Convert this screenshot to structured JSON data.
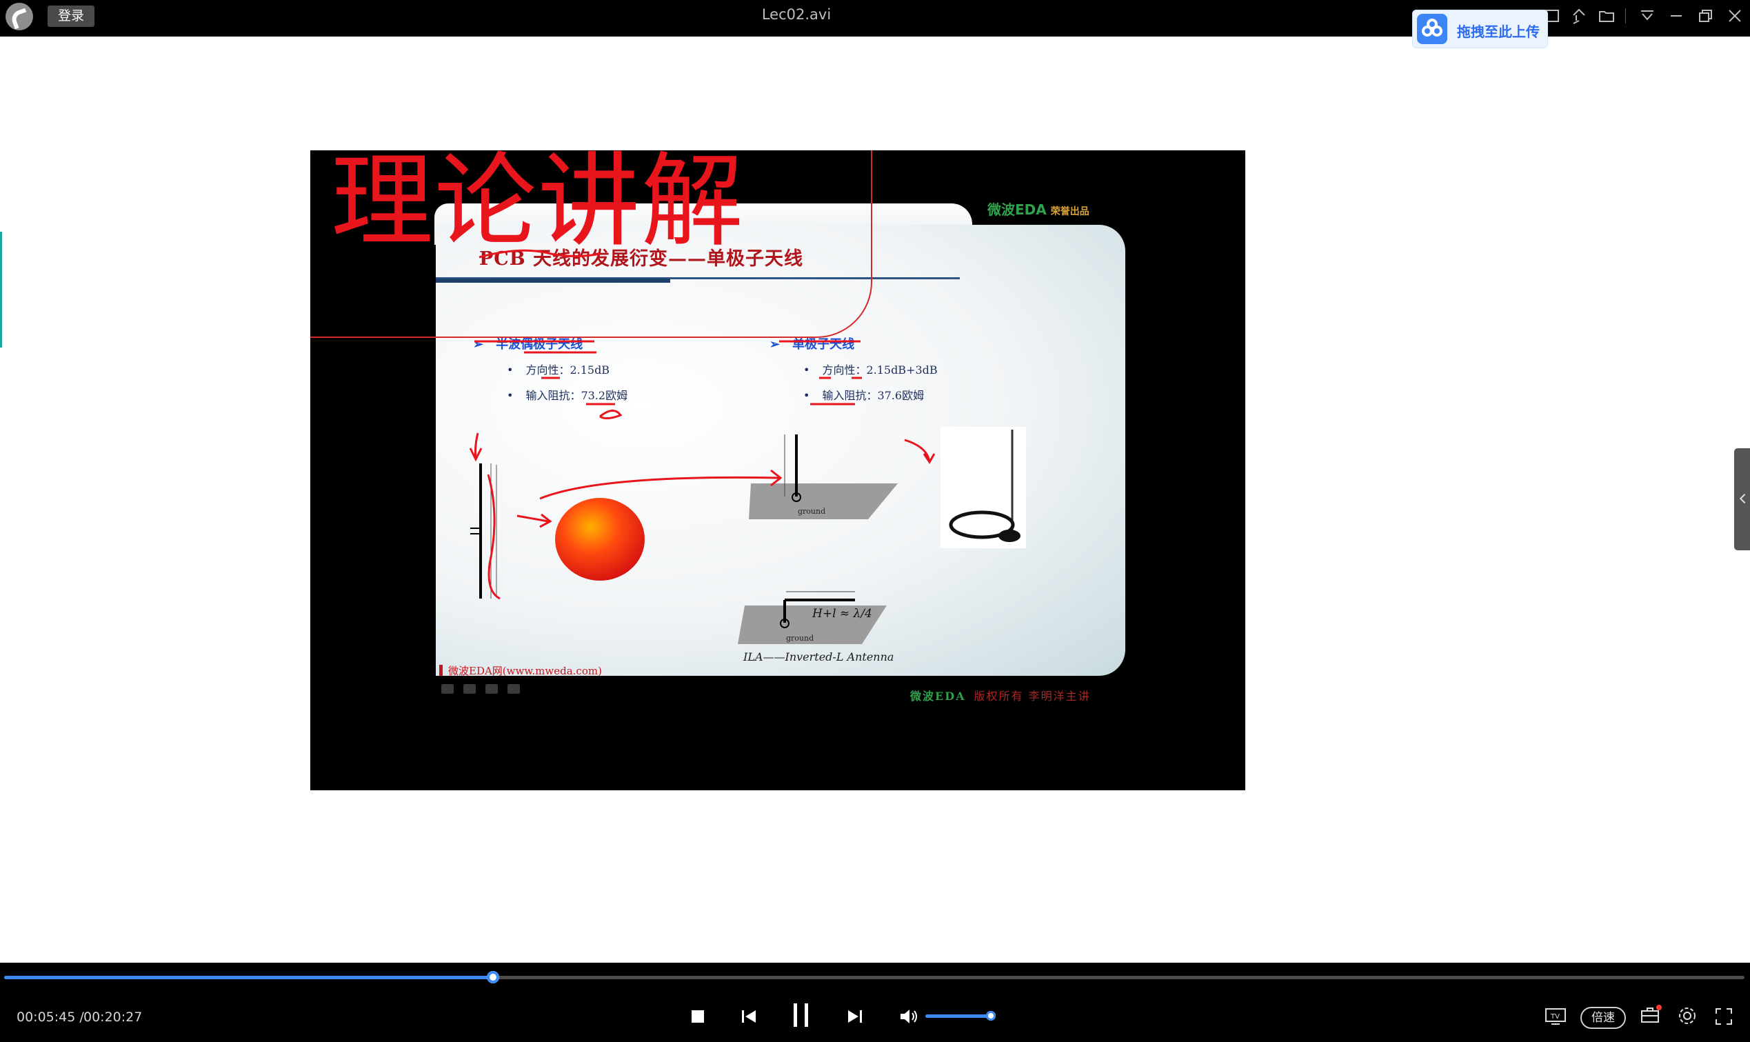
{
  "window": {
    "title": "Lec02.avi",
    "login_label": "登录",
    "upload_badge": "拖拽至此上传"
  },
  "slide": {
    "annotation_heading": "理论讲解",
    "title": "PCB 天线的发展衍变——单极子天线",
    "brand": "微波EDA",
    "brand_sub": "荣誉出品",
    "left_column": {
      "heading": "半波偶极子天线",
      "bullets": [
        "方向性：2.15dB",
        "输入阻抗：73.2欧姆"
      ]
    },
    "right_column": {
      "heading": "单极子天线",
      "bullets": [
        "方向性：2.15dB+3dB",
        "输入阻抗：37.6欧姆"
      ]
    },
    "ground_label": "ground",
    "ground_label_2": "ground",
    "formula": "H+l ≈ λ/4",
    "ila_caption": "ILA——Inverted-L Antenna",
    "footer": "微波EDA网(www.mweda.com)",
    "copyright": "版权所有  李明洋主讲",
    "copyright_brand": "微波EDA"
  },
  "player": {
    "current_time": "00:05:45 /",
    "total_time": "00:20:27",
    "progress_fraction": 0.281,
    "volume_fraction": 1.0,
    "speed_label": "倍速",
    "accent_color": "#3c8cf7"
  },
  "icons": [
    "app-logo-icon",
    "pin-icon",
    "folder-icon",
    "menu-icon",
    "minimize-icon",
    "restore-icon",
    "close-icon",
    "stop-icon",
    "previous-icon",
    "pause-icon",
    "next-icon",
    "volume-icon",
    "tv-cast-icon",
    "toolbox-icon",
    "settings-icon",
    "fullscreen-icon"
  ]
}
